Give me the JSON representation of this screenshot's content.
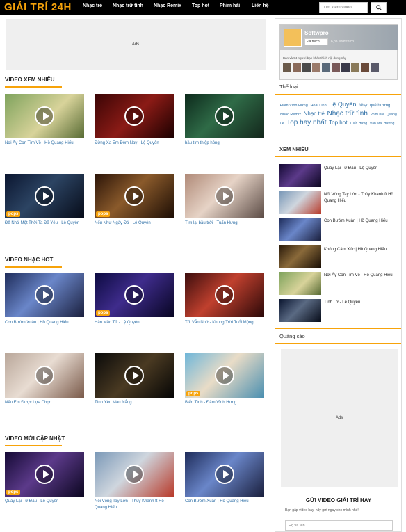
{
  "header": {
    "logo": "GIẢI TRÍ 24H",
    "nav": [
      "Nhạc trẻ",
      "Nhạc trữ tình",
      "Nhạc Remix",
      "Top hot",
      "Phim hài",
      "Liên hệ"
    ],
    "search_placeholder": "Tìm kiếm video..."
  },
  "ads_label": "Ads",
  "sections": [
    {
      "title": "VIDEO XEM NHIỀU",
      "videos": [
        {
          "title": "Nơi Ấy Con Tìm Về - Hồ Quang Hiếu",
          "badge": ""
        },
        {
          "title": "Đừng Xa Em Đêm Nay - Lệ Quyên",
          "badge": ""
        },
        {
          "title": "bầu tím thiệp hồng",
          "badge": ""
        },
        {
          "title": "Để Nhớ Một Thời Ta Đã Yêu - Lệ Quyên",
          "badge": "pops"
        },
        {
          "title": "Nếu Như Ngày Đó - Lệ Quyên",
          "badge": "pops"
        },
        {
          "title": "Tìm lại bầu trời - Tuấn Hưng",
          "badge": ""
        }
      ]
    },
    {
      "title": "VIDEO NHẠC HOT",
      "videos": [
        {
          "title": "Con Bướm Xuân | Hồ Quang Hiếu",
          "badge": ""
        },
        {
          "title": "Hàn Mặc Tử - Lệ Quyên",
          "badge": "pops"
        },
        {
          "title": "Tối Vẫn Nhớ - Khung Trời Tuổi Mộng",
          "badge": ""
        },
        {
          "title": "Nếu Em Được Lựa Chọn",
          "badge": ""
        },
        {
          "title": "Tình Yêu Màu Nắng",
          "badge": ""
        },
        {
          "title": "Biển Tình - Đàm Vĩnh Hưng",
          "badge": "pops"
        }
      ]
    },
    {
      "title": "VIDEO MỚI CẬP NHẬT",
      "videos": [
        {
          "title": "Quay Lại Từ Đầu - Lệ Quyên",
          "badge": "pops"
        },
        {
          "title": "Nối Vòng Tay Lớn - Thùy Khanh ft Hồ Quang Hiếu",
          "badge": ""
        },
        {
          "title": "Con Bướm Xuân | Hồ Quang Hiếu",
          "badge": ""
        }
      ]
    }
  ],
  "sidebar": {
    "fb": {
      "name": "Softwpro",
      "like": "Đã thích",
      "count": "6,8K lượt thích",
      "friends": "Bạn và 94 người bạn khác thích nội dung này"
    },
    "tags_title": "Thể loại",
    "tags": [
      "Đàm Vĩnh Hưng",
      "Hoài Linh",
      "Lệ Quyên",
      "Nhạc quê hương",
      "Nhạc Remix",
      "Nhạc trẻ",
      "Nhạc trữ tình",
      "Phim hài",
      "Quang Lê",
      "Top hay nhất",
      "Top hot",
      "Tuấn Hưng",
      "Văn Mai Hương"
    ],
    "most_viewed_title": "XEM NHIỀU",
    "most_viewed": [
      "Quay Lại Từ Đầu - Lệ Quyên",
      "Nối Vòng Tay Lớn - Thùy Khanh ft Hồ Quang Hiếu",
      "Con Bướm Xuân | Hồ Quang Hiếu",
      "Không Cảm Xúc | Hồ Quang Hiếu",
      "Nơi Ấy Con Tìm Về - Hồ Quang Hiếu",
      "Tình Lỡ - Lệ Quyên"
    ],
    "ads_title": "Quảng cáo",
    "submit_title": "GỬI VIDEO GIẢI TRÍ HAY",
    "submit_desc": "Bạn gặp video hay, hãy gửi ngay cho mình nhé!",
    "name_placeholder": "Họ và tên"
  }
}
